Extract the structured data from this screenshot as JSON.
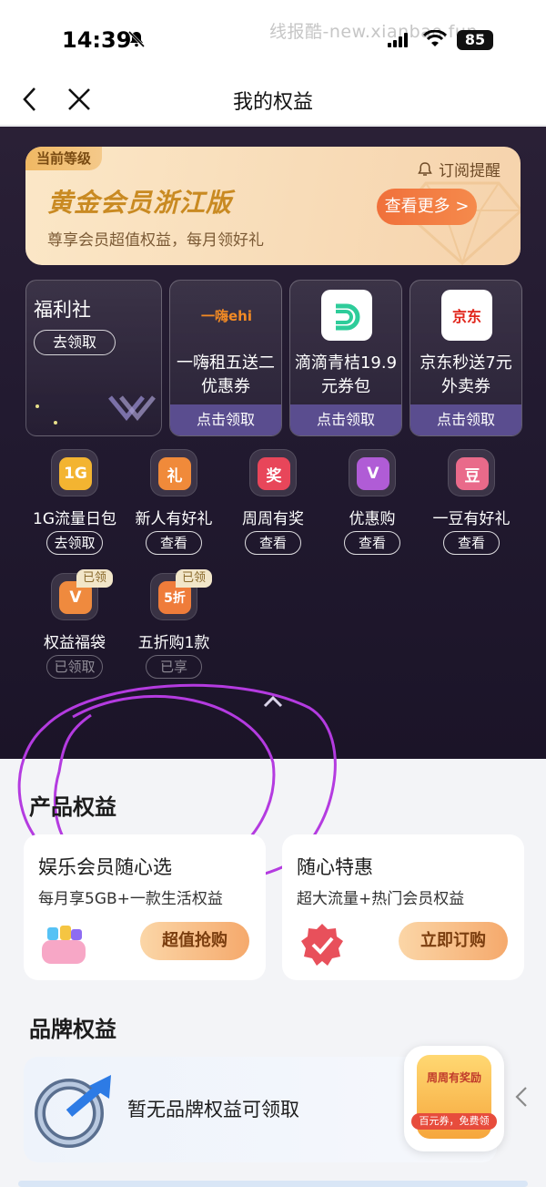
{
  "status": {
    "time": "14:39",
    "watermark": "线报酷-new.xianbao.fun",
    "battery": "85"
  },
  "nav": {
    "title": "我的权益"
  },
  "vip": {
    "tag": "当前等级",
    "subscribe": "订阅提醒",
    "level": "黄金会员浙江版",
    "desc": "尊享会员超值权益，每月领好礼",
    "more": "查看更多 >"
  },
  "welfare": {
    "name": "福利社",
    "button": "去领取"
  },
  "coupons": [
    {
      "logo_text": "一嗨ehi",
      "text": "一嗨租五送二优惠券",
      "action": "点击领取",
      "icon": "ehi-logo"
    },
    {
      "logo_text": "",
      "text": "滴滴青桔19.9元券包",
      "action": "点击领取",
      "icon": "didi-logo"
    },
    {
      "logo_text": "京东",
      "text": "京东秒送7元外卖券",
      "action": "点击领取",
      "icon": "jd-logo"
    }
  ],
  "benefits": [
    {
      "label": "1G流量日包",
      "button": "去领取",
      "glyph": "1G",
      "color": "#f3b431",
      "icon": "data-pack-icon"
    },
    {
      "label": "新人有好礼",
      "button": "查看",
      "glyph": "礼",
      "color": "#f08a3a",
      "icon": "gift-icon"
    },
    {
      "label": "周周有奖",
      "button": "查看",
      "glyph": "奖",
      "color": "#e8465a",
      "icon": "prize-icon"
    },
    {
      "label": "优惠购",
      "button": "查看",
      "glyph": "V",
      "color": "#b05cd6",
      "icon": "discount-icon"
    },
    {
      "label": "一豆有好礼",
      "button": "查看",
      "glyph": "豆",
      "color": "#e96a8a",
      "icon": "bean-gift-icon"
    },
    {
      "label": "权益福袋",
      "button": "已领取",
      "glyph": "V",
      "color": "#ef8a3e",
      "badge": "已领",
      "icon": "lucky-bag-icon"
    },
    {
      "label": "五折购1款",
      "button": "已享",
      "glyph": "5折",
      "color": "#ef7c3a",
      "badge": "已领",
      "icon": "half-price-icon"
    }
  ],
  "product": {
    "title": "产品权益",
    "cards": [
      {
        "name": "娱乐会员随心选",
        "desc": "每月享5GB+一款生活权益",
        "button": "超值抢购",
        "icon": "entertainment-basket-icon"
      },
      {
        "name": "随心特惠",
        "desc": "超大流量+热门会员权益",
        "button": "立即订购",
        "icon": "check-badge-icon"
      }
    ]
  },
  "brand": {
    "title": "品牌权益",
    "empty_text": "暂无品牌权益可领取",
    "float_title": "周周有奖励",
    "float_sub": "百元券，免费领"
  },
  "colors": {
    "dark_bg": "#221a30",
    "gold": "#c98a22",
    "accent_orange": "#f0703a",
    "annotation_purple": "#b43be0"
  }
}
